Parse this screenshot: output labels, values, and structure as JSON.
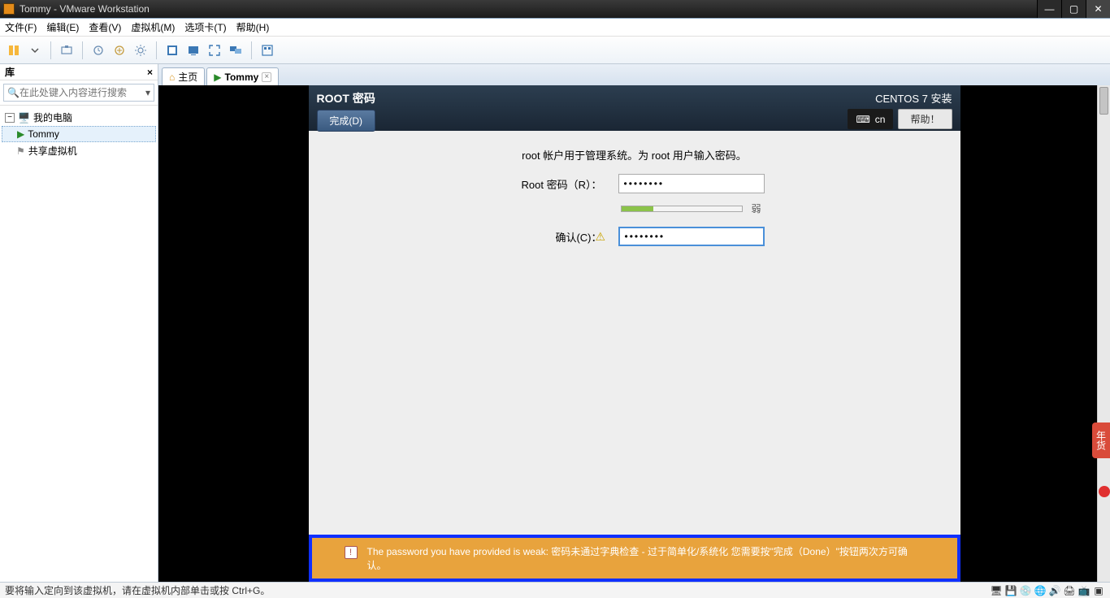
{
  "window": {
    "title": "Tommy - VMware Workstation"
  },
  "menu": {
    "file": "文件(F)",
    "edit": "编辑(E)",
    "view": "查看(V)",
    "vm": "虚拟机(M)",
    "tabs": "选项卡(T)",
    "help": "帮助(H)"
  },
  "sidebar": {
    "title": "库",
    "search_placeholder": "在此处键入内容进行搜索",
    "tree": {
      "root": "我的电脑",
      "item1": "Tommy",
      "item2": "共享虚拟机"
    }
  },
  "tabs": {
    "home": "主页",
    "vm": "Tommy"
  },
  "installer": {
    "title": "ROOT 密码",
    "done": "完成(D)",
    "distro": "CENTOS 7 安装",
    "kbd": "cn",
    "help": "帮助！",
    "desc": "root 帐户用于管理系统。为 root 用户输入密码。",
    "pw_label": "Root 密码（R）：",
    "confirm_label": "确认(C)：",
    "pw_value": "••••••••",
    "confirm_value": "••••••••",
    "strength": "弱",
    "warning": "The password you have provided is weak: 密码未通过字典检查 - 过于简单化/系统化 您需要按\"完成（Done）\"按钮两次方可确认。"
  },
  "statusbar": {
    "msg": "要将输入定向到该虚拟机，请在虚拟机内部单击或按 Ctrl+G。"
  },
  "widget": {
    "label": "年货"
  }
}
